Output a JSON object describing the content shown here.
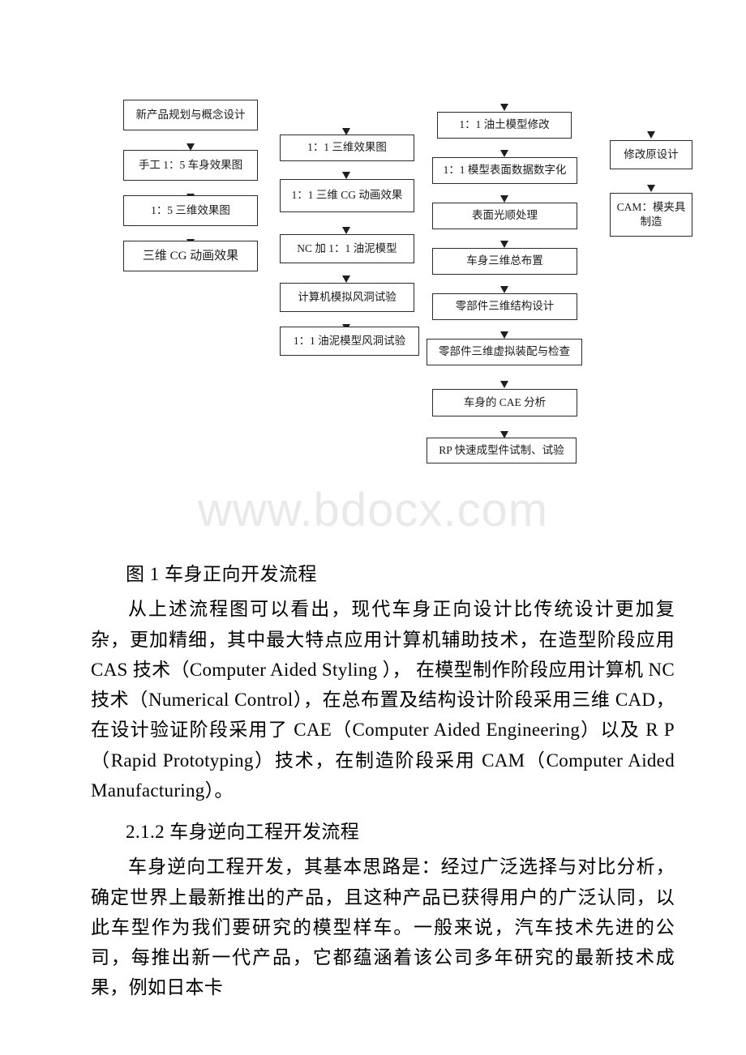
{
  "watermark": {
    "text": "www.bdocx.com"
  },
  "flowchart": {
    "column1": [
      {
        "id": "n1",
        "label": "新产品规划与概念设计"
      },
      {
        "id": "n2",
        "label": "手工 1：5 车身效果图"
      },
      {
        "id": "n3",
        "label": "1：5 三维效果图"
      },
      {
        "id": "n4",
        "label": "三维 CG 动画效果"
      }
    ],
    "column2": [
      {
        "id": "n5",
        "label": "1：1 三维效果图"
      },
      {
        "id": "n6",
        "label": "1：1 三维 CG 动画效果"
      },
      {
        "id": "n7",
        "label": "NC 加 1：1 油泥模型"
      },
      {
        "id": "n8",
        "label": "计算机模拟风洞试验"
      },
      {
        "id": "n9",
        "label": "1：1 油泥模型风洞试验"
      }
    ],
    "column3": [
      {
        "id": "n10",
        "label": "1：1 油土模型修改"
      },
      {
        "id": "n11",
        "label": "1：1 模型表面数据数字化"
      },
      {
        "id": "n12",
        "label": "表面光顺处理"
      },
      {
        "id": "n13",
        "label": "车身三维总布置"
      },
      {
        "id": "n14",
        "label": "零部件三维结构设计"
      },
      {
        "id": "n15",
        "label": "零部件三维虚拟装配与检查"
      },
      {
        "id": "n16",
        "label": "车身的 CAE 分析"
      },
      {
        "id": "n17",
        "label": "RP 快速成型件试制、试验"
      }
    ],
    "column4": [
      {
        "id": "n18",
        "label": "修改原设计"
      },
      {
        "id": "n19",
        "label": "CAM：模夹具\n制造"
      }
    ]
  },
  "document": {
    "figure_caption": "图 1 车身正向开发流程",
    "paragraph_1": "从上述流程图可以看出，现代车身正向设计比传统设计更加复杂，更加精细，其中最大特点应用计算机辅助技术，在造型阶段应用 CAS 技术（Computer Aided Styling ）， 在模型制作阶段应用计算机 NC 技术（Numerical Control），在总布置及结构设计阶段采用三维 CAD，在设计验证阶段采用了 CAE（Computer Aided Engineering）以及 R P（Rapid Prototyping）技术，在制造阶段采用 CAM（Computer Aided Manufacturing）。",
    "section_heading": "2.1.2 车身逆向工程开发流程",
    "paragraph_2": "车身逆向工程开发，其基本思路是：经过广泛选择与对比分析，确定世界上最新推出的产品，且这种产品已获得用户的广泛认同，以此车型作为我们要研究的模型样车。一般来说，汽车技术先进的公司，每推出新一代产品，它都蕴涵着该公司多年研究的最新技术成果，例如日本卡"
  }
}
